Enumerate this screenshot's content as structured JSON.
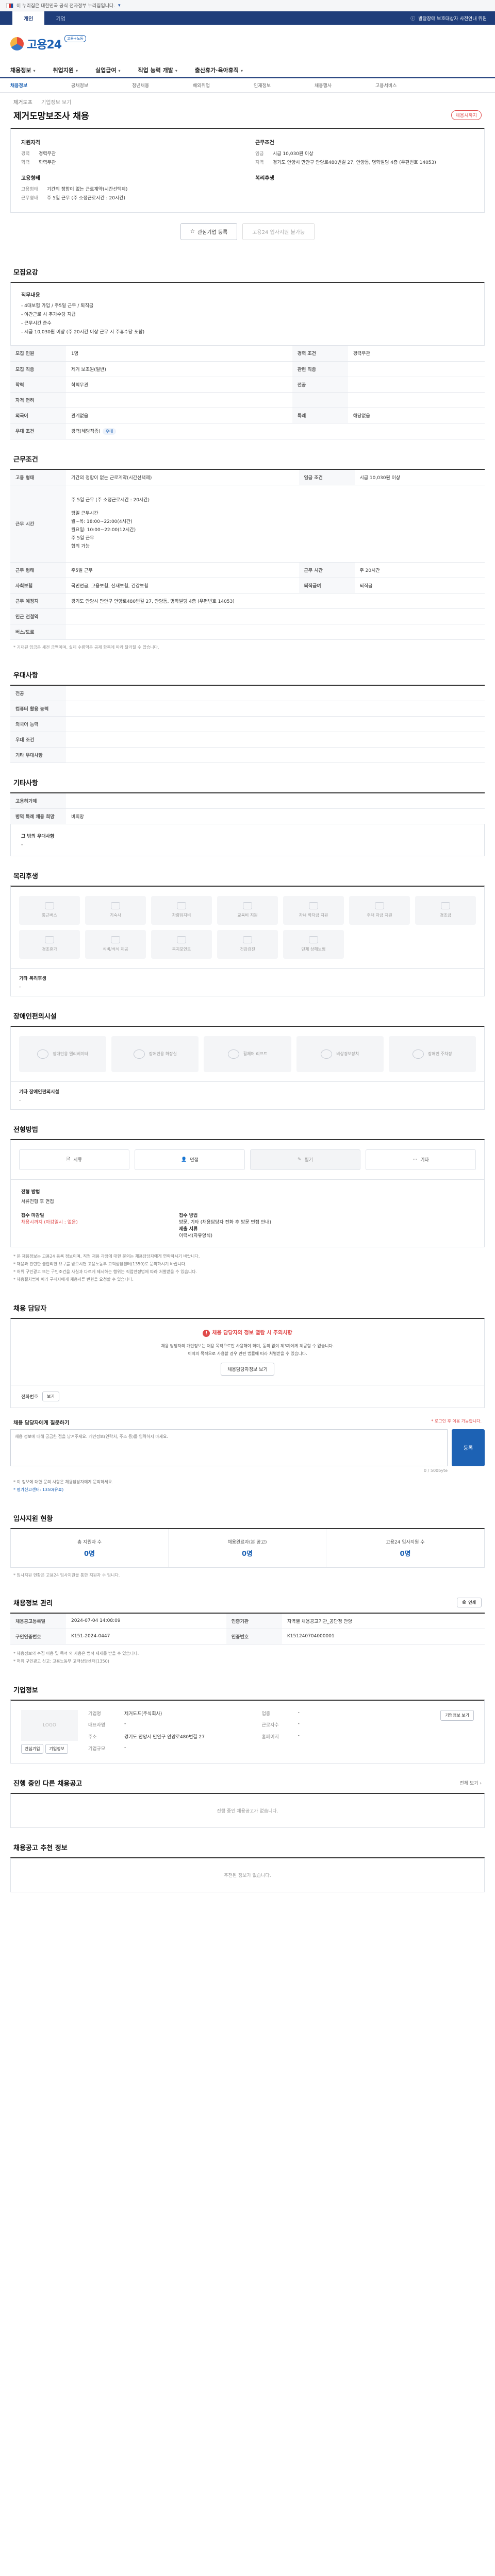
{
  "gov_bar": {
    "text": "이 누리집은 대한민국 공식 전자정부 누리집입니다."
  },
  "top_tabs": {
    "items": [
      "개인",
      "기업"
    ],
    "active": 0,
    "notice": "발달장애 보호대상자 사전안내 위원"
  },
  "logo": {
    "text": "고용24",
    "tag": "고용+노동"
  },
  "gnb": {
    "items": [
      "채용정보",
      "취업지원",
      "실업급여",
      "직업 능력 개발",
      "출산휴가·육아휴직"
    ]
  },
  "lnb": {
    "items": [
      "채용정보",
      "공채정보",
      "청년채용",
      "해외취업",
      "인재정보",
      "채용행사",
      "고용서비스"
    ],
    "active": 0
  },
  "job": {
    "company": "제거도프",
    "company_sub": "기업정보 보기",
    "title": "제거도망보조사 채용",
    "deadline_badge": "채용시까지",
    "summary": {
      "left_title": "지원자격",
      "left": [
        {
          "k": "경력",
          "v": "경력무관"
        },
        {
          "k": "학력",
          "v": "학력무관"
        }
      ],
      "right_title": "근무조건",
      "right": [
        {
          "k": "임금",
          "v": "시급 10,030원 이상"
        },
        {
          "k": "지역",
          "v": "경기도 안양시 만안구 안양로480번길 27, 안양동, 명학빌딩 4층 (우편번호 14053)"
        }
      ],
      "left2_title": "고용형태",
      "left2": [
        {
          "k": "고용형태",
          "v": "기간의 정함이 없는 근로계약(시간선택제)"
        },
        {
          "k": "근무형태",
          "v": "주 5일 근무 (주 소정근로시간 : 20시간)"
        }
      ],
      "right2_title": "복리후생",
      "right2": []
    }
  },
  "actions": {
    "apply": "온라인 입사지원",
    "interest": "관심기업 등록",
    "apply_disabled": "고용24 입사지원 불가능"
  },
  "sections": {
    "recruit": "모집요강",
    "work": "근무조건",
    "prefer": "우대사항",
    "etc": "기타사항",
    "welfare": "복리후생",
    "disability": "장애인편의시설",
    "screening": "전형방법",
    "contact": "채용 담당자",
    "reco": "입사지원 현황",
    "info": "채용정보 관리",
    "corp": "기업정보",
    "similar": "진행 중인 다른 채용공고",
    "matching": "채용공고 추천 정보"
  },
  "recruit": {
    "duty_title": "직무내용",
    "duty_lines": [
      "- 4대보험 가입 / 주5일 근무 / 퇴직금",
      "- 야간근로 시 추가수당 지급",
      "- 근무시간 준수",
      "- 시급 10,030원 이상 (주 20시간 이상 근무 시 주휴수당 포함)"
    ],
    "rows": [
      {
        "k": "모집 인원",
        "v": "1명",
        "k2": "경력 조건",
        "v2": "경력무관"
      },
      {
        "k": "모집 직종",
        "v": "제거 보조원(일반)",
        "k2": "관련 직종",
        "v2": ""
      },
      {
        "k": "학력",
        "v": "학력무관",
        "k2": "전공",
        "v2": ""
      },
      {
        "k": "자격 면허",
        "v": "",
        "k2": "",
        "v2": ""
      },
      {
        "k": "외국어",
        "v": "관계없음",
        "k2": "특례",
        "v2": "해당없음"
      },
      {
        "k": "우대 조건",
        "v": "경력(해당직종)",
        "k2": "",
        "v2": ""
      }
    ],
    "tag": "우대"
  },
  "work": {
    "rows": [
      {
        "k": "고용 형태",
        "v": "기간의 정함이 없는 근로계약(시간선택제)",
        "k2": "임금 조건",
        "v2": "시급 10,030원 이상"
      },
      {
        "k": "근무 시간",
        "v": "주 5일 근무 (주 소정근로시간 : 20시간)",
        "k2": "",
        "v2": ""
      },
      {
        "k": "근무 형태",
        "v": "주5일 근무",
        "k2": "근무 시간",
        "v2": "주 20시간"
      },
      {
        "k": "사회보험",
        "v": "국민연금, 고용보험, 산재보험, 건강보험",
        "k2": "퇴직급여",
        "v2": "퇴직금"
      },
      {
        "k": "근무 예정지",
        "v": "경기도 안양시 만안구 안양로480번길 27, 안양동, 명학빌딩 4층 (우편번호 14053)",
        "k2": "",
        "v2": ""
      },
      {
        "k": "인근 전철역",
        "v": "",
        "k2": "",
        "v2": ""
      },
      {
        "k": "버스/도로",
        "v": "",
        "k2": "",
        "v2": ""
      }
    ],
    "schedule": [
      "평일 근무시간",
      "월~목: 18:00~22:00(4시간)",
      "월요일: 10:00~22:00(12시간)",
      "주 5일 근무",
      "협의 가능"
    ],
    "note": "* 기재된 임금은 세전 금액이며, 실제 수령액은 공제 항목에 따라 달라질 수 있습니다."
  },
  "prefer": {
    "rows": [
      {
        "k": "전공",
        "v": ""
      },
      {
        "k": "컴퓨터 활용 능력",
        "v": ""
      },
      {
        "k": "외국어 능력",
        "v": ""
      },
      {
        "k": "우대 조건",
        "v": ""
      },
      {
        "k": "기타 우대사항",
        "v": ""
      }
    ]
  },
  "etc": {
    "rows": [
      {
        "k": "고용허가제",
        "v": ""
      },
      {
        "k": "병역 특례 채용 희망",
        "v": "비희망"
      }
    ],
    "extra_title": "그 밖의 우대사항",
    "extra_value": "-"
  },
  "welfare": {
    "items": [
      "통근버스",
      "기숙사",
      "차량유지비",
      "교육비 지원",
      "자녀 학자금 지원",
      "주택 자금 지원",
      "경조금"
    ],
    "items2": [
      "경조휴가",
      "식비/석식 제공",
      "복지포인트",
      "건강검진",
      "단체 상해보험"
    ],
    "extra_title": "기타 복리후생",
    "extra_value": "-"
  },
  "disability": {
    "items": [
      "장애인용 엘리베이터",
      "장애인용 화장실",
      "휠체어 리프트",
      "비상경보장치",
      "장애인 주차장"
    ],
    "extra_title": "기타 장애인편의시설",
    "extra_value": "-"
  },
  "screening": {
    "methods": [
      "서류",
      "면접",
      "필기",
      "기타"
    ],
    "process_title": "전형 방법",
    "process_value": "서류전형 후 면접",
    "period_title": "접수 마감일",
    "period_value": "채용시까지 (마감일시 : 없음)",
    "doc_title": "접수 방법",
    "doc_value": "방문, 기타 (채용담당자 전화 후 방문 면접 안내)",
    "papers_title": "제출 서류",
    "papers_value": "이력서(자유양식)",
    "bullets": [
      "* 본 채용정보는 고용24 등록 정보이며, 직접 채용 과정에 대한 문의는 채용담당자에게 연락하시기 바랍니다.",
      "* 채용과 관련한 불합리한 요구를 받으시면 고용노동부 고객상담센터(1350)로 문의하시기 바랍니다.",
      "* 허위 구인광고 또는 구인조건을 사실과 다르게 제시하는 행위는 직업안정법에 따라 처벌받을 수 있습니다.",
      "* 채용절차법에 따라 구직자에게 채용서류 반환을 요청할 수 있습니다."
    ]
  },
  "contact": {
    "warning": "채용 담당자의 정보 열람 시 주의사항",
    "desc1": "채용 담당자의 개인정보는 채용 목적으로만 사용해야 하며, 동의 없이 제3자에게 제공할 수 없습니다.",
    "desc2": "이외의 목적으로 사용할 경우 관련 법률에 따라 처벌받을 수 있습니다.",
    "button": "채용담당자정보 보기",
    "phone_label": "전화번호",
    "phone_button": "보기"
  },
  "inquiry": {
    "title": "채용 담당자에게 질문하기",
    "hint": "* 로그인 후 이용 가능합니다.",
    "placeholder": "채용 정보에 대해 궁금한 점을 남겨주세요. 개인정보(연락처, 주소 등)를 입력하지 마세요.",
    "counter": "0 / 500byte",
    "submit": "등록",
    "notes": [
      "* 이 정보에 대한 문의 사항은 채용담당자에게 문의하세요.",
      "* 평가신고센터: 1350(유료)"
    ]
  },
  "reco": {
    "items": [
      {
        "label": "총 지원자 수",
        "value": "0명"
      },
      {
        "label": "채용완료자(본 공고)",
        "value": "0명"
      },
      {
        "label": "고용24 입사지원 수",
        "value": "0명"
      }
    ],
    "note": "* 입사지원 현황은 고용24 입사지원을 통한 지원자 수 입니다."
  },
  "info": {
    "rows": [
      {
        "k": "채용공고등록일",
        "v": "2024-07-04 14:08:09",
        "k2": "인증기관",
        "v2": "지역별 채용공고기관_공단청 안양"
      },
      {
        "k": "구인인증번호",
        "v": "K151-2024-0447",
        "k2": "인증번호",
        "v2": "K151240704000001"
      }
    ],
    "print_button": "인쇄",
    "notes": [
      "* 채용정보의 수집 이용 및 목적 외 사용은 법적 제재를 받을 수 있습니다.",
      "* 허위 구인광고 신고: 고용노동부 고객상담센터(1350)"
    ]
  },
  "corp": {
    "logo_placeholder": "LOGO",
    "logo_buttons": [
      "관심기업",
      "기업정보"
    ],
    "rows": [
      {
        "k": "기업명",
        "v": "제거도프(주식회사)",
        "k2": "업종",
        "v2": "-"
      },
      {
        "k": "대표자명",
        "v": "-",
        "k2": "근로자수",
        "v2": "-"
      },
      {
        "k": "주소",
        "v": "경기도 안양시 만안구 안양로480번길 27",
        "k2": "홈페이지",
        "v2": "-"
      },
      {
        "k": "기업규모",
        "v": "-",
        "k2": "",
        "v2": ""
      }
    ],
    "detail_button": "기업정보 보기"
  },
  "similar": {
    "more": "전체 보기",
    "empty": "진행 중인 채용공고가 없습니다."
  },
  "matching": {
    "empty": "추천된 정보가 없습니다."
  }
}
